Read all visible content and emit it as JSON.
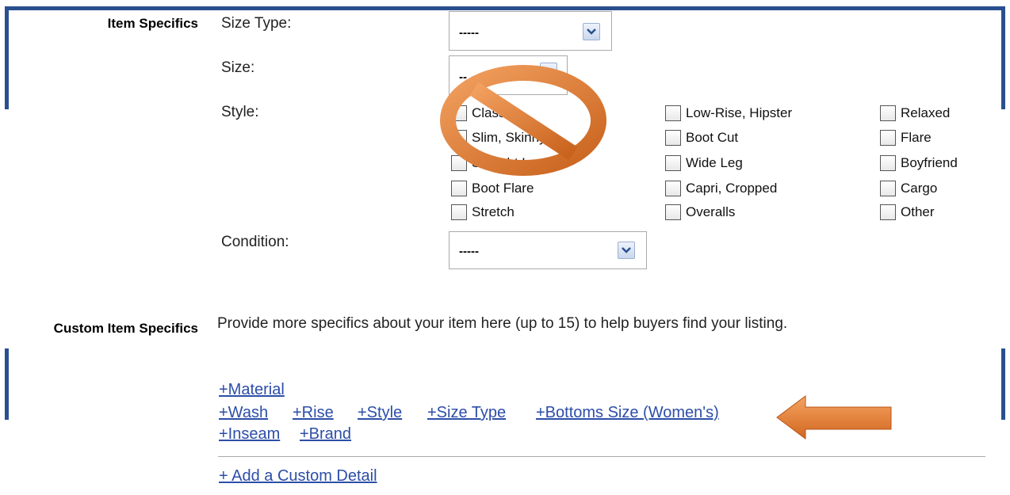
{
  "sections": {
    "item_specifics": "Item Specifics",
    "custom_item_specifics": "Custom Item Specifics"
  },
  "fields": {
    "size_type": {
      "label": "Size Type:",
      "value": "-----"
    },
    "size": {
      "label": "Size:",
      "value": "--"
    },
    "style": {
      "label": "Style:"
    },
    "condition": {
      "label": "Condition:",
      "value": "-----"
    }
  },
  "style_options": [
    "Classic",
    "Slim, Skinny",
    "Straight Leg",
    "Boot Flare",
    "Stretch",
    "Low-Rise, Hipster",
    "Boot Cut",
    "Wide Leg",
    "Capri, Cropped",
    "Overalls",
    "Relaxed",
    "Flare",
    "Boyfriend",
    "Cargo",
    "Other"
  ],
  "custom": {
    "description": "Provide more specifics about your item here (up to 15) to help buyers find your listing.",
    "links": [
      "+Material",
      "+Wash",
      "+Rise",
      "+Style",
      "+Size Type",
      "+Bottoms Size (Women's)",
      "+Inseam",
      "+Brand"
    ],
    "add_custom_detail": "+ Add a Custom Detail"
  },
  "annotations": {
    "no_sign_color": "#e07a2a",
    "arrow_color": "#e07a2a"
  }
}
